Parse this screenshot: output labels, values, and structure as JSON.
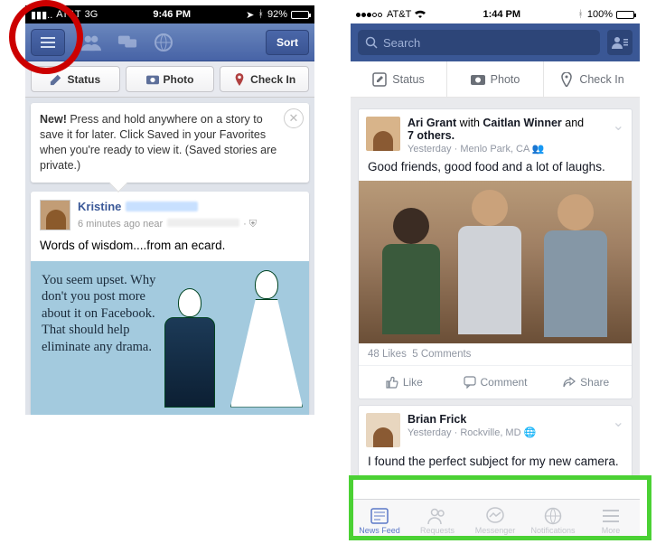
{
  "left": {
    "status": {
      "carrier": "AT&T",
      "net": "3G",
      "time": "9:46 PM",
      "battery": "92%"
    },
    "nav": {
      "sort": "Sort"
    },
    "actions": {
      "status": "Status",
      "photo": "Photo",
      "checkin": "Check In"
    },
    "tip": {
      "bold": "New!",
      "text": " Press and hold anywhere on a story to save it for later. Click Saved in your Favorites when you're ready to view it. (Saved stories are private.)"
    },
    "story": {
      "author": "Kristine",
      "meta": "6 minutes ago near",
      "text": "Words of wisdom....from an ecard.",
      "ecard": "You seem upset. Why don't you post more about it on Facebook. That should help eliminate any drama."
    }
  },
  "right": {
    "status": {
      "carrier": "AT&T",
      "time": "1:44 PM",
      "battery": "100%"
    },
    "search": {
      "placeholder": "Search"
    },
    "actions": {
      "status": "Status",
      "photo": "Photo",
      "checkin": "Check In"
    },
    "story1": {
      "author": "Ari Grant",
      "with": " with ",
      "coauthor": "Caitlan Winner",
      "and": " and ",
      "others": "7 others.",
      "time": "Yesterday",
      "loc": "Menlo Park, CA",
      "text": "Good friends, good food and a lot of laughs.",
      "likes": "48 Likes",
      "comments": "5 Comments"
    },
    "actrow": {
      "like": "Like",
      "comment": "Comment",
      "share": "Share"
    },
    "story2": {
      "author": "Brian Frick",
      "time": "Yesterday",
      "loc": "Rockville, MD",
      "text": "I found the perfect subject for my new camera."
    },
    "tabs": {
      "feed": "News Feed",
      "requests": "Requests",
      "messenger": "Messenger",
      "notifications": "Notifications",
      "more": "More"
    }
  }
}
